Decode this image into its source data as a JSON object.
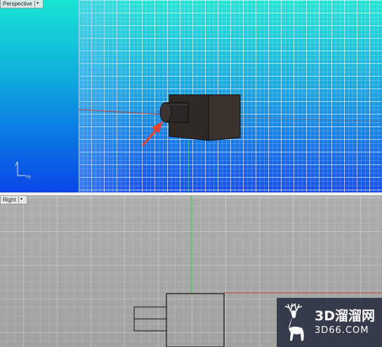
{
  "viewports": {
    "perspective": {
      "label": "Perspective",
      "dropdown_icon": "triangle-down-icon"
    },
    "right": {
      "label": "Right",
      "dropdown_icon": "triangle-down-icon"
    }
  },
  "axis_widget": {
    "label": "xy"
  },
  "annotation": {
    "arrow_color": "#e8412c"
  },
  "colors": {
    "viewport_top": "#18e4d2",
    "viewport_bottom": "#0a45e8",
    "right_viewport_bg": "#a9a9a9",
    "x_axis": "#c0453a",
    "z_axis": "#2fbf4a",
    "object": "#2e2824"
  },
  "watermark": {
    "title": "3D溜溜网",
    "subtitle": "3D66.COM",
    "logo": "deer-logo"
  }
}
